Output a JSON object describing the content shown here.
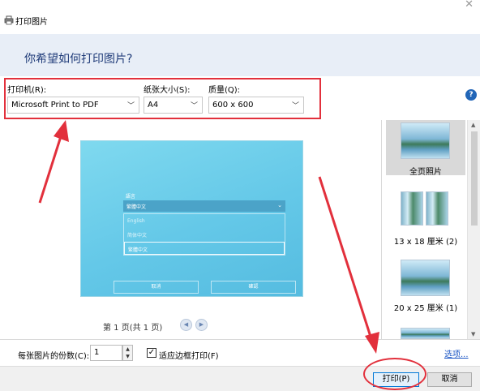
{
  "window": {
    "title": "打印图片",
    "close_glyph": "✕"
  },
  "header": {
    "question": "你希望如何打印图片?"
  },
  "options": {
    "printer_label": "打印机(R):",
    "printer_value": "Microsoft Print to PDF",
    "paper_label": "纸张大小(S):",
    "paper_value": "A4",
    "quality_label": "质量(Q):",
    "quality_value": "600 x 600",
    "help_glyph": "?"
  },
  "preview": {
    "language_label": "語言",
    "dropdown_value": "繁體中文",
    "list_items": [
      "English",
      "简体中文",
      "繁體中文"
    ],
    "cancel_label": "取消",
    "ok_label": "確認"
  },
  "page_nav": {
    "text": "第 1 页(共 1 页)"
  },
  "thumbnails": [
    {
      "label": "全页照片",
      "selected": true
    },
    {
      "label": "13 x 18 厘米 (2)",
      "selected": false
    },
    {
      "label": "20 x 25 厘米 (1)",
      "selected": false
    }
  ],
  "bottom": {
    "copies_label": "每张图片的份数(C):",
    "copies_value": "1",
    "fit_label": "适应边框打印(F)",
    "fit_checked": true,
    "options_link": "选项..."
  },
  "footer": {
    "print_label": "打印(P)",
    "cancel_label": "取消"
  },
  "colors": {
    "annotation_red": "#e2303c",
    "header_text": "#1e3a78",
    "link_blue": "#1a55c4"
  }
}
